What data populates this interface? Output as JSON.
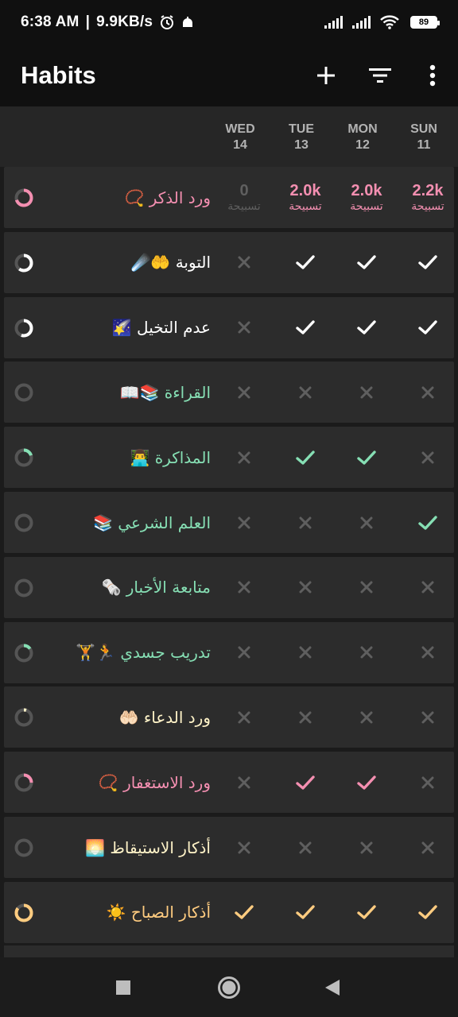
{
  "status_bar": {
    "time": "6:38 AM",
    "speed": "9.9KB/s",
    "battery": "89"
  },
  "app_bar": {
    "title": "Habits",
    "icons": [
      "plus-icon",
      "filter-icon",
      "more-vert-icon"
    ]
  },
  "days": [
    {
      "name": "WED",
      "date": "14"
    },
    {
      "name": "TUE",
      "date": "13"
    },
    {
      "name": "MON",
      "date": "12"
    },
    {
      "name": "SUN",
      "date": "11"
    }
  ],
  "colors": {
    "pink": "#f48fb1",
    "green": "#7ed7a6",
    "orange": "#ffcc80",
    "white": "#ffffff",
    "dim": "#5f5f5f",
    "accent_text_green": "#86dfb4",
    "text_yellow": "#fff3c8"
  },
  "habits": [
    {
      "name": "ورد الذكر 📿",
      "color": "#f48fb1",
      "type": "numeric",
      "values": [
        "0",
        "2.0k",
        "2.0k",
        "2.2k"
      ],
      "unit": "تسبيحة",
      "ring": 0.7
    },
    {
      "name": "التوبة 🤲☄️",
      "color": "#ffffff",
      "type": "check",
      "values": [
        "x",
        "v",
        "v",
        "v"
      ],
      "ring": 0.6
    },
    {
      "name": "عدم التخيل 🌠",
      "color": "#ffffff",
      "type": "check",
      "values": [
        "x",
        "v",
        "v",
        "v"
      ],
      "ring": 0.55
    },
    {
      "name": "القراءة 📚📖",
      "color": "#86dfb4",
      "type": "check",
      "values": [
        "x",
        "x",
        "x",
        "x"
      ],
      "ring": 0.0
    },
    {
      "name": "المذاكرة 👨‍💻",
      "color": "#86dfb4",
      "type": "check",
      "values": [
        "x",
        "v",
        "v",
        "x"
      ],
      "ring": 0.2
    },
    {
      "name": "العلم الشرعي 📚",
      "color": "#86dfb4",
      "type": "check",
      "values": [
        "x",
        "x",
        "x",
        "v"
      ],
      "ring": 0.0
    },
    {
      "name": "متابعة الأخبار 🗞️",
      "color": "#86dfb4",
      "type": "check",
      "values": [
        "x",
        "x",
        "x",
        "x"
      ],
      "ring": 0.0
    },
    {
      "name": "تدريب جسدي 🏃🏋️",
      "color": "#86dfb4",
      "type": "check",
      "values": [
        "x",
        "x",
        "x",
        "x"
      ],
      "ring": 0.15
    },
    {
      "name": "ورد الدعاء 🤲🏻",
      "color": "#fff3c8",
      "type": "check",
      "values": [
        "x",
        "x",
        "x",
        "x"
      ],
      "ring": 0.05
    },
    {
      "name": "ورد الاستغفار 📿",
      "color": "#f48fb1",
      "type": "check",
      "values": [
        "x",
        "v",
        "v",
        "x"
      ],
      "ring": 0.25
    },
    {
      "name": "أذكار الاستيقاظ 🌅",
      "color": "#fff3c8",
      "type": "check",
      "values": [
        "x",
        "x",
        "x",
        "x"
      ],
      "ring": 0.0
    },
    {
      "name": "أذكار الصباح ☀️",
      "color": "#ffcc80",
      "type": "check",
      "values": [
        "v",
        "v",
        "v",
        "v"
      ],
      "ring": 0.85
    }
  ],
  "nav": [
    "recents-square-icon",
    "home-circle-icon",
    "back-triangle-icon"
  ]
}
